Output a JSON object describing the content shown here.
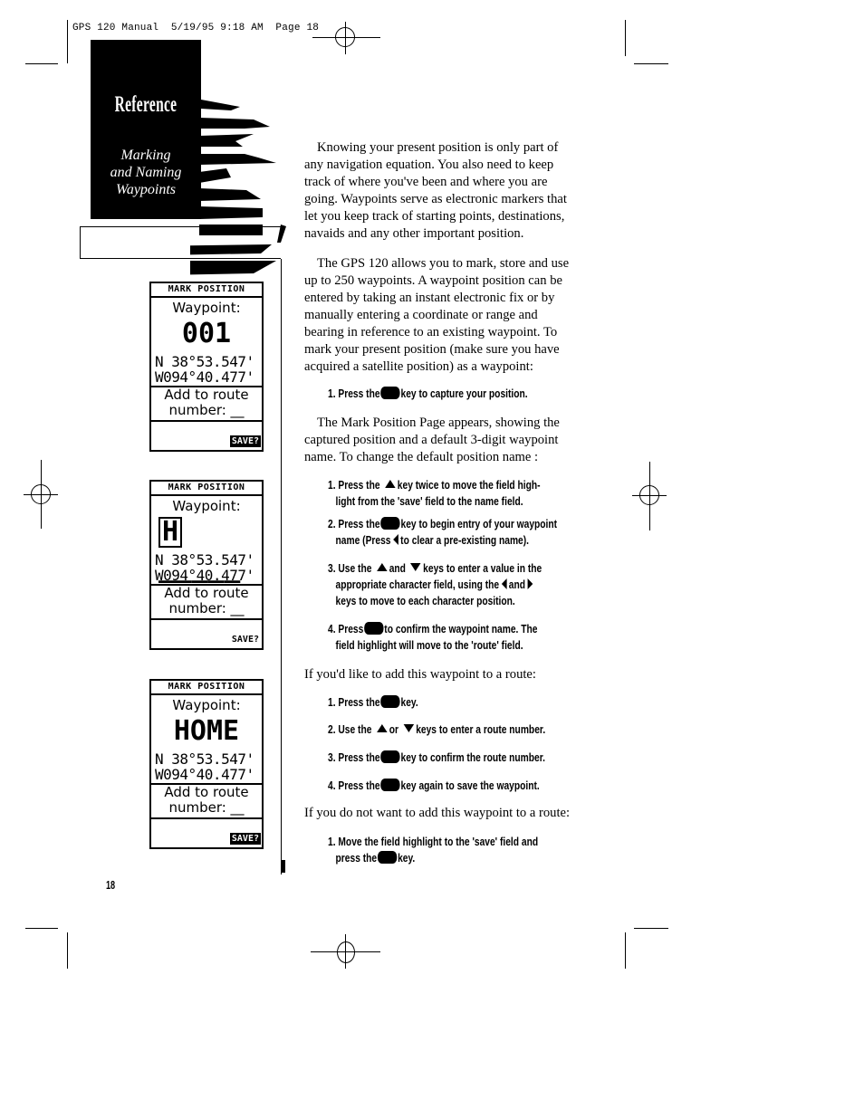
{
  "slug": {
    "text": "GPS 120 Manual  5/19/95 9:18 AM  Page 18"
  },
  "chapter_tab": {
    "title": "Reference",
    "subtitle_lines": [
      "Marking",
      "and Naming",
      "Waypoints"
    ]
  },
  "gps_screens": [
    {
      "header": "MARK POSITION",
      "waypoint_label": "Waypoint:",
      "name": "001",
      "lat": "N 38°53.547'",
      "lon": "W094°40.477'",
      "route_line1": "Add to route",
      "route_line2": "number: __",
      "save": "SAVE?",
      "save_highlighted": true
    },
    {
      "header": "MARK POSITION",
      "waypoint_label": "Waypoint:",
      "name_cursor": "H",
      "name_rest": "_____",
      "lat": "N 38°53.547'",
      "lon": "W094°40.477'",
      "route_line1": "Add to route",
      "route_line2": "number: __",
      "save": "SAVE?",
      "save_highlighted": false
    },
    {
      "header": "MARK POSITION",
      "waypoint_label": "Waypoint:",
      "name": "HOME",
      "lat": "N 38°53.547'",
      "lon": "W094°40.477'",
      "route_line1": "Add to route",
      "route_line2": "number: __",
      "save": "SAVE?",
      "save_highlighted": true
    }
  ],
  "body": {
    "p1": "Knowing your present position is only part of any navigation equation. You also need to keep track of where you've been and where you are going. Waypoints serve as electronic markers that let you keep track of starting points, destinations, navaids and any other important position.",
    "p2": "The GPS 120 allows you to mark, store and use up to 250 waypoints. A waypoint position can be entered by taking an instant electronic fix or by manually entering a coordinate or range and bearing in reference to an existing waypoint. To mark your present position (make sure you have acquired a satellite position) as a waypoint:",
    "step_mark": {
      "a": "1. Press the",
      "b": "key to capture your position."
    },
    "p3": "The Mark Position Page appears, showing the captured position and a default 3-digit waypoint name. To change the default position name :",
    "rename_steps": {
      "s1a": "1. Press the",
      "s1b": "key twice to move the field high-",
      "s1c": "light from the 'save' field to the name field.",
      "s2a": "2. Press the",
      "s2b": "key to begin entry of your waypoint",
      "s2c": "name (Press",
      "s2d": "to clear a pre-existing name).",
      "s3a": "3. Use the",
      "s3b": "and",
      "s3c": "keys to enter a value in the",
      "s3d": "appropriate character field, using the",
      "s3e": "and",
      "s3f": "keys to move to each character position.",
      "s4a": "4. Press",
      "s4b": "to confirm the waypoint name. The",
      "s4c": "field highlight will move to the 'route' field."
    },
    "p4": "If you'd like to add this waypoint to a route:",
    "route_steps": {
      "s1a": "1. Press the",
      "s1b": "key.",
      "s2a": "2. Use the",
      "s2b": "or",
      "s2c": "keys to enter a route number.",
      "s3a": "3. Press the",
      "s3b": "key to confirm the route number.",
      "s4a": "4. Press the",
      "s4b": "key again to save the waypoint."
    },
    "p5": "If you do not want to add this waypoint to a route:",
    "save_step": {
      "a": "1. Move the field highlight to the 'save' field and",
      "b": "press the",
      "c": "key."
    }
  },
  "icons": {
    "mark_key": "mark-key-icon",
    "enter_key": "enter-key-icon",
    "up": "up-arrow-key-icon",
    "down": "down-arrow-key-icon",
    "left": "left-arrow-key-icon",
    "right": "right-arrow-key-icon"
  },
  "page_number": "18"
}
